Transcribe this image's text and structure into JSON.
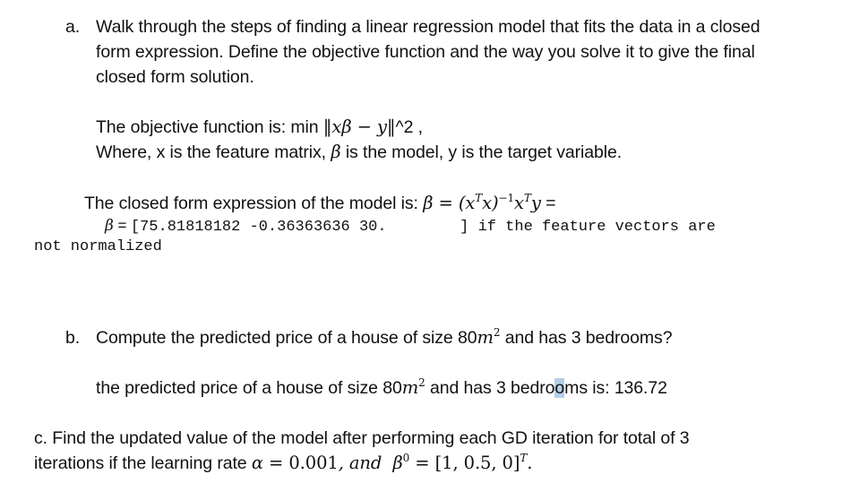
{
  "part_a": {
    "label": "a.",
    "question_lines": [
      "Walk through the steps of finding a linear regression model that fits the data in a closed",
      "form expression. Define the objective function and the way you solve it to give the final",
      "closed form solution."
    ],
    "objective_prefix": "The objective function is: min ",
    "objective_math": "‖xβ − y‖",
    "objective_suffix": "^2 ,",
    "where_prefix": "Where, x is the feature matrix, ",
    "where_beta": "β",
    "where_suffix": " is the model, y is the target variable.",
    "closed_form_prefix": "The closed form expression of the model is: ",
    "closed_form_beta": "β",
    "closed_form_eq": " = (x",
    "closed_form_T1": "T",
    "closed_form_x": "x)",
    "closed_form_inv": "−1",
    "closed_form_x2": "x",
    "closed_form_T2": "T",
    "closed_form_y": "y",
    "closed_form_tail": " =",
    "beta_result_symbol": "β",
    "beta_result_eq": " = ",
    "beta_result_values": "[75.81818182 -0.36363636 30.        ] if the feature vectors are",
    "beta_result_wrap": "not normalized"
  },
  "part_b": {
    "label": "b.",
    "question_prefix": "Compute the predicted price of a house of size 80",
    "question_unit": "m",
    "question_exp": "2",
    "question_suffix": " and has 3 bedrooms?",
    "answer_prefix": "the predicted price of a house of size 80",
    "answer_unit": "m",
    "answer_exp": "2",
    "answer_mid_a": " and has 3 bedro",
    "answer_highlight": "o",
    "answer_mid_b": "ms is: ",
    "answer_value": "136.72"
  },
  "part_c": {
    "line1": "c. Find the updated value of the model after performing each GD iteration for total of 3",
    "line2_prefix": "iterations if the learning rate ",
    "alpha": "α",
    "alpha_eq": " = ",
    "alpha_value": "0.001",
    "and_text": ", and  ",
    "beta": "β",
    "beta_sup": "0",
    "beta_eq": " = ",
    "beta_value": "[1, 0.5, 0]",
    "beta_T": "T",
    "end": "."
  }
}
